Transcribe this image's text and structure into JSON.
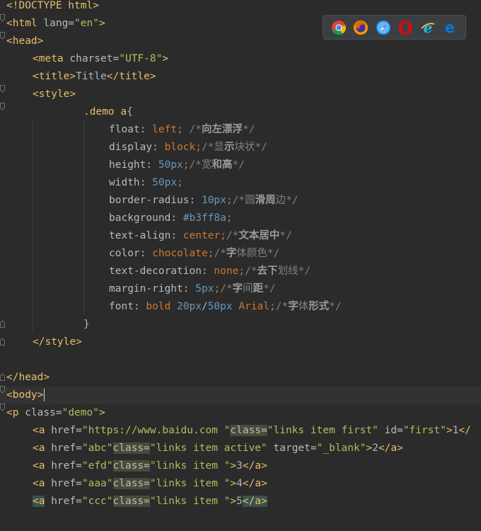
{
  "browsers": [
    {
      "name": "chrome-icon",
      "color": "#4285f4"
    },
    {
      "name": "firefox-icon",
      "color": "#e66000"
    },
    {
      "name": "safari-icon",
      "color": "#1e90ff"
    },
    {
      "name": "opera-icon",
      "color": "#cc0f16"
    },
    {
      "name": "ie-icon",
      "color": "#1ebbee"
    },
    {
      "name": "edge-icon",
      "color": "#0078d7"
    }
  ],
  "code": {
    "l1": {
      "doctype": "<!DOCTYPE html>"
    },
    "l2": {
      "open": "<html ",
      "attr": "lang=",
      "val": "\"en\"",
      "close": ">"
    },
    "l3": {
      "tag": "<head>"
    },
    "l4": {
      "open": "<meta ",
      "attr": "charset=",
      "val": "\"UTF-8\"",
      "close": ">"
    },
    "l5": {
      "open": "<title>",
      "text": "Title",
      "close": "</title>"
    },
    "l6": {
      "tag": "<style>"
    },
    "l7": {
      "selector": ".demo a",
      "brace": "{"
    },
    "l8": {
      "prop": "float",
      "colon": ": ",
      "val": "left",
      "semi": ";",
      "c1": " /*",
      "cb": "向左漂浮",
      "c2": "*/"
    },
    "l9": {
      "prop": "display",
      "colon": ": ",
      "val": "block",
      "semi": ";",
      "c1": "/*显",
      "cb": "示",
      "c2": "块状*/"
    },
    "l10": {
      "prop": "height",
      "colon": ": ",
      "num": "50px",
      "semi": ";",
      "c1": "/*宽",
      "cb": "和高",
      "c2": "*/"
    },
    "l11": {
      "prop": "width",
      "colon": ": ",
      "num": "50px",
      "semi": ";"
    },
    "l12": {
      "prop": "border-radius",
      "colon": ": ",
      "num": "10px",
      "semi": ";",
      "c1": "/*圆",
      "cb": "滑周",
      "c2": "边*/"
    },
    "l13": {
      "prop": "background",
      "colon": ": ",
      "hex": "#b3ff8a",
      "semi": ";"
    },
    "l14": {
      "prop": "text-align",
      "colon": ": ",
      "val": "center",
      "semi": ";",
      "c1": "/*",
      "cb": "文本居中",
      "c2": "*/"
    },
    "l15": {
      "prop": "color",
      "colon": ": ",
      "val": "chocolate",
      "semi": ";",
      "c1": "/*",
      "cb": "字",
      "c2": "体颜色*/"
    },
    "l16": {
      "prop": "text-decoration",
      "colon": ": ",
      "val": "none",
      "semi": ";",
      "c1": "/*",
      "cb": "去下",
      "c2": "划线*/"
    },
    "l17": {
      "prop": "margin-right",
      "colon": ": ",
      "num": "5px",
      "semi": ";",
      "c1": "/*",
      "cb": "字",
      "c2": "间",
      "cb2": "距",
      "c3": "*/"
    },
    "l18": {
      "prop": "font",
      "colon": ": ",
      "val": "bold ",
      "num": "20px",
      "sl": "/",
      "num2": "50px",
      "val2": " Arial",
      "semi": ";",
      "c1": "/*",
      "cb": "字",
      "c2": "体",
      "cb2": "形式",
      "c3": "*/"
    },
    "l19": {
      "brace": "}"
    },
    "l20": {
      "tag": "</style>"
    },
    "l22": {
      "tag": "</head>"
    },
    "l23": {
      "tag": "<body>"
    },
    "l24": {
      "open": "<p ",
      "attr": "class=",
      "val": "\"demo\"",
      "close": ">"
    },
    "l25": {
      "open": "<a ",
      "attr": "href=",
      "val": "\"https://www.baidu.com \"",
      "attr2": "class=",
      "val2": "\"links item first\"",
      "attr3": " id=",
      "val3": "\"first\"",
      "close": ">",
      "text": "1",
      "end": "</"
    },
    "l26": {
      "open": "<a ",
      "attr": "href=",
      "val": "\"abc\"",
      "attr2": "class=",
      "val2": "\"links item active\"",
      "attr3": " target=",
      "val3": "\"_blank\"",
      "close": ">",
      "text": "2",
      "end": "</a>"
    },
    "l27": {
      "open": "<a ",
      "attr": "href=",
      "val": "\"efd\"",
      "attr2": "class=",
      "val2": "\"links item \"",
      "close": ">",
      "text": "3",
      "end": "</a>"
    },
    "l28": {
      "open": "<a ",
      "attr": "href=",
      "val": "\"aaa\"",
      "attr2": "class=",
      "val2": "\"links item \"",
      "close": ">",
      "text": "4",
      "end": "</a>"
    },
    "l29": {
      "open": "<a",
      "sp": " ",
      "attr": "href=",
      "val": "\"ccc\"",
      "attr2": "class=",
      "val2": "\"links item \"",
      "close": ">",
      "text": "5",
      "end": "</a>"
    }
  }
}
